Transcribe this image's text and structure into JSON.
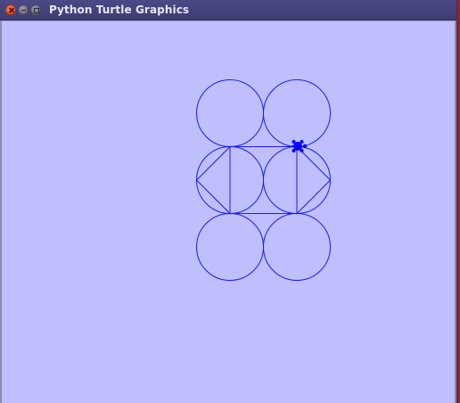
{
  "window": {
    "title": "Python Turtle Graphics",
    "controls": {
      "close_icon": "close-icon",
      "minimize_icon": "minimize-icon",
      "maximize_icon": "maximize-icon"
    }
  },
  "canvas": {
    "background_color": "#bfbffe",
    "pen_color": "#1a1aff",
    "turtle_color": "#0000ff",
    "turtle_icon": "turtle-icon"
  }
}
